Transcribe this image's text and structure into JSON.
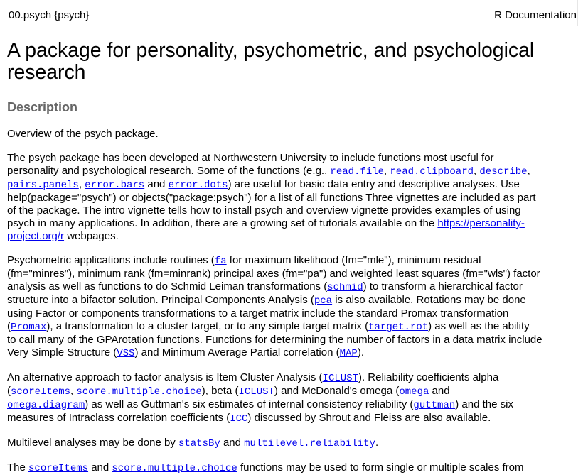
{
  "header": {
    "topic": "00.psych {psych}",
    "label": "R Documentation"
  },
  "title": "A package for personality, psychometric, and psychological research",
  "section": "Description",
  "p1": "Overview of the psych package.",
  "p2": {
    "l1": "The psych package has been developed at Northwestern University to include functions most useful for",
    "l2a": "personality and psychological research. Some of the functions (e.g., ",
    "l2b": "read.file",
    "l2c": ", ",
    "l2d": "read.clipboard",
    "l2e": ", ",
    "l2f": "describe",
    "l2g": ",",
    "l3a": "pairs.panels",
    "l3b": ", ",
    "l3c": "error.bars",
    "l3d": " and ",
    "l3e": "error.dots",
    "l3f": ") are useful for basic data entry and descriptive analyses. Use",
    "l4": "help(package=\"psych\") or objects(\"package:psych\") for a list of all functions Three vignettes are included as part",
    "l5": "of the package. The intro vignette tells how to install psych and overview vignette provides examples of using",
    "l6a": "psych in many applications. In addition, there are a growing set of tutorials available on the ",
    "l6b": "https://personality-",
    "l7a": "project.org/r",
    "l7b": " webpages."
  },
  "p3": {
    "l1a": "Psychometric applications include routines (",
    "l1b": "fa",
    "l1c": " for maximum likelihood (fm=\"mle\"), minimum residual",
    "l2": "(fm=\"minres\"), minimum rank (fm=minrank) principal axes (fm=\"pa\") and weighted least squares (fm=\"wls\") factor",
    "l3a": "analysis as well as functions to do Schmid Leiman transformations (",
    "l3b": "schmid",
    "l3c": ") to transform a hierarchical factor",
    "l4a": "structure into a bifactor solution. Principal Components Analysis (",
    "l4b": "pca",
    "l4c": " is also available. Rotations may be done",
    "l5": "using Factor or components transformations to a target matrix include the standard Promax transformation",
    "l6a": "(",
    "l6b": "Promax",
    "l6c": "), a transformation to a cluster target, or to any simple target matrix (",
    "l6d": "target.rot",
    "l6e": ") as well as the ability",
    "l7": "to call many of the GPArotation functions. Functions for determining the number of factors in a data matrix include",
    "l8a": "Very Simple Structure (",
    "l8b": "VSS",
    "l8c": ") and Minimum Average Partial correlation (",
    "l8d": "MAP",
    "l8e": ")."
  },
  "p4": {
    "l1a": "An alternative approach to factor analysis is Item Cluster Analysis (",
    "l1b": "ICLUST",
    "l1c": "). Reliability coefficients alpha",
    "l2a": "(",
    "l2b": "scoreItems",
    "l2c": ", ",
    "l2d": "score.multiple.choice",
    "l2e": "), beta (",
    "l2f": "ICLUST",
    "l2g": ") and McDonald's omega (",
    "l2h": "omega",
    "l2i": " and",
    "l3a": "omega.diagram",
    "l3b": ") as well as Guttman's six estimates of internal consistency reliability (",
    "l3c": "guttman",
    "l3d": ") and the six",
    "l4a": "measures of Intraclass correlation coefficients (",
    "l4b": "ICC",
    "l4c": ") discussed by Shrout and Fleiss are also available."
  },
  "p5": {
    "a": "Multilevel analyses may be done by ",
    "b": "statsBy",
    "c": " and ",
    "d": "multilevel.reliability",
    "e": "."
  },
  "p6": {
    "a": "The ",
    "b": "scoreItems",
    "c": " and ",
    "d": "score.multiple.choice",
    "e": " functions may be used to form single or multiple scales from"
  }
}
